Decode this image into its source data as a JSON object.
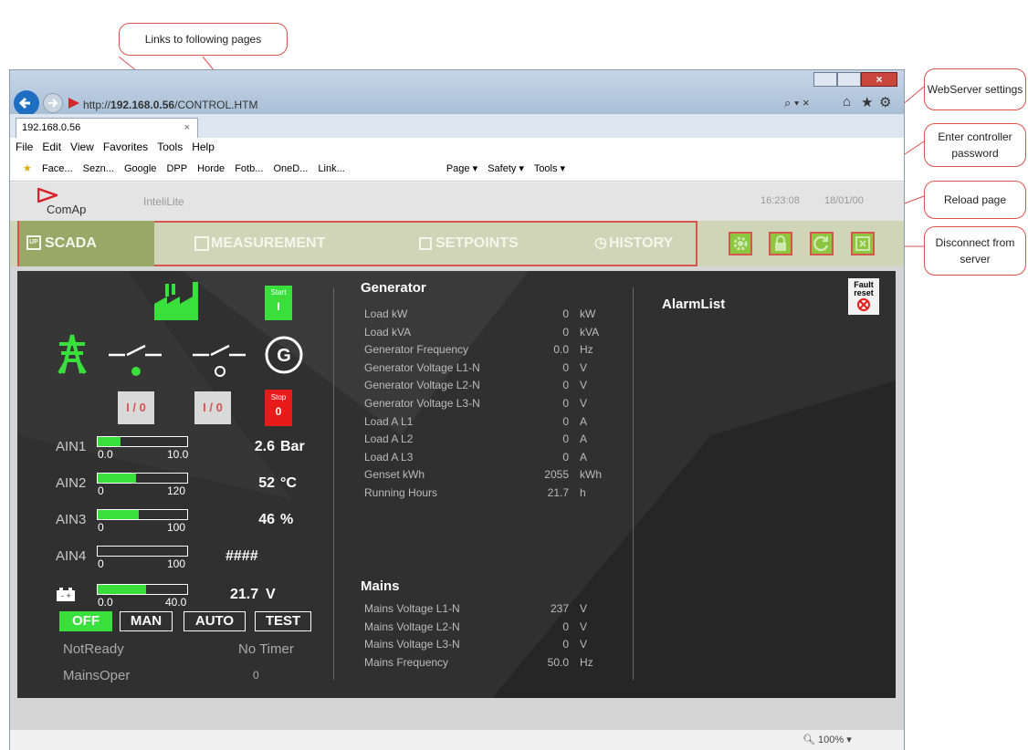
{
  "callouts": {
    "links": "Links to following pages",
    "webserver": "WebServer settings",
    "password": "Enter controller password",
    "reload": "Reload page",
    "disconnect": "Disconnect from server"
  },
  "browser": {
    "address_prefix": "http://",
    "address_host": "192.168.0.56",
    "address_path": "/CONTROL.HTM",
    "tab_title": "192.168.0.56",
    "menu": [
      "File",
      "Edit",
      "View",
      "Favorites",
      "Tools",
      "Help"
    ],
    "favorites": [
      "Face...",
      "Sezn...",
      "Google",
      "DPP",
      "Horde",
      "Fotb...",
      "OneD...",
      "Link..."
    ],
    "toolbar_right": [
      "Page ▾",
      "Safety ▾",
      "Tools ▾"
    ],
    "zoom": "100%"
  },
  "app": {
    "brand": "ComAp",
    "product": "InteliLite",
    "time": "16:23:08",
    "date": "18/01/00",
    "tabs": [
      "SCADA",
      "MEASUREMENT",
      "SETPOINTS",
      "HISTORY"
    ]
  },
  "scada": {
    "start_label": "Start",
    "start_value": "I",
    "stop_label": "Stop",
    "stop_value": "0",
    "breaker1": "I / 0",
    "breaker2": "I / 0",
    "ains": [
      {
        "name": "AIN1",
        "min": "0.0",
        "max": "10.0",
        "value": "2.6",
        "unit": "Bar",
        "level": 0.26
      },
      {
        "name": "AIN2",
        "min": "0",
        "max": "120",
        "value": "52",
        "unit": "°C",
        "level": 0.43
      },
      {
        "name": "AIN3",
        "min": "0",
        "max": "100",
        "value": "46",
        "unit": "%",
        "level": 0.46
      },
      {
        "name": "AIN4",
        "min": "0",
        "max": "100",
        "value": "####",
        "unit": "",
        "level": 0.0
      }
    ],
    "battery": {
      "min": "0.0",
      "max": "40.0",
      "value": "21.7",
      "unit": "V",
      "level": 0.54
    },
    "modes": [
      "OFF",
      "MAN",
      "AUTO",
      "TEST"
    ],
    "state": "NotReady",
    "timer": "No Timer",
    "mains_state": "MainsOper",
    "timer_value": "0"
  },
  "generator": {
    "title": "Generator",
    "rows": [
      {
        "label": "Load kW",
        "value": "0",
        "unit": "kW"
      },
      {
        "label": "Load kVA",
        "value": "0",
        "unit": "kVA"
      },
      {
        "label": "Generator Frequency",
        "value": "0.0",
        "unit": "Hz"
      },
      {
        "label": "Generator Voltage L1-N",
        "value": "0",
        "unit": "V"
      },
      {
        "label": "Generator Voltage L2-N",
        "value": "0",
        "unit": "V"
      },
      {
        "label": "Generator Voltage L3-N",
        "value": "0",
        "unit": "V"
      },
      {
        "label": "Load A L1",
        "value": "0",
        "unit": "A"
      },
      {
        "label": "Load A L2",
        "value": "0",
        "unit": "A"
      },
      {
        "label": "Load A L3",
        "value": "0",
        "unit": "A"
      },
      {
        "label": "Genset kWh",
        "value": "2055",
        "unit": "kWh"
      },
      {
        "label": "Running Hours",
        "value": "21.7",
        "unit": "h"
      }
    ]
  },
  "mains": {
    "title": "Mains",
    "rows": [
      {
        "label": "Mains Voltage L1-N",
        "value": "237",
        "unit": "V"
      },
      {
        "label": "Mains Voltage L2-N",
        "value": "0",
        "unit": "V"
      },
      {
        "label": "Mains Voltage L3-N",
        "value": "0",
        "unit": "V"
      },
      {
        "label": "Mains Frequency",
        "value": "50.0",
        "unit": "Hz"
      }
    ]
  },
  "alarm": {
    "title": "AlarmList",
    "fault_reset_1": "Fault",
    "fault_reset_2": "reset"
  }
}
